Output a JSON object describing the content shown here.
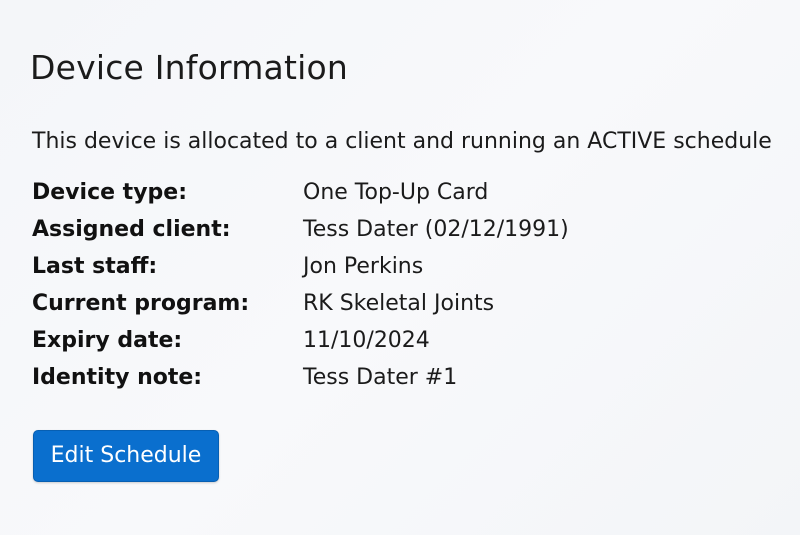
{
  "panel": {
    "title": "Device Information",
    "status_text": "This device is allocated to a client and running an ACTIVE schedule"
  },
  "details": [
    {
      "label": "Device type:",
      "value": "One Top-Up Card"
    },
    {
      "label": "Assigned client:",
      "value": "Tess Dater (02/12/1991)"
    },
    {
      "label": "Last staff:",
      "value": "Jon Perkins"
    },
    {
      "label": "Current program:",
      "value": "RK Skeletal Joints"
    },
    {
      "label": "Expiry date:",
      "value": "11/10/2024"
    },
    {
      "label": "Identity note:",
      "value": "Tess Dater #1"
    }
  ],
  "actions": {
    "edit_schedule_label": "Edit Schedule",
    "button_color": "#0a6fce"
  }
}
